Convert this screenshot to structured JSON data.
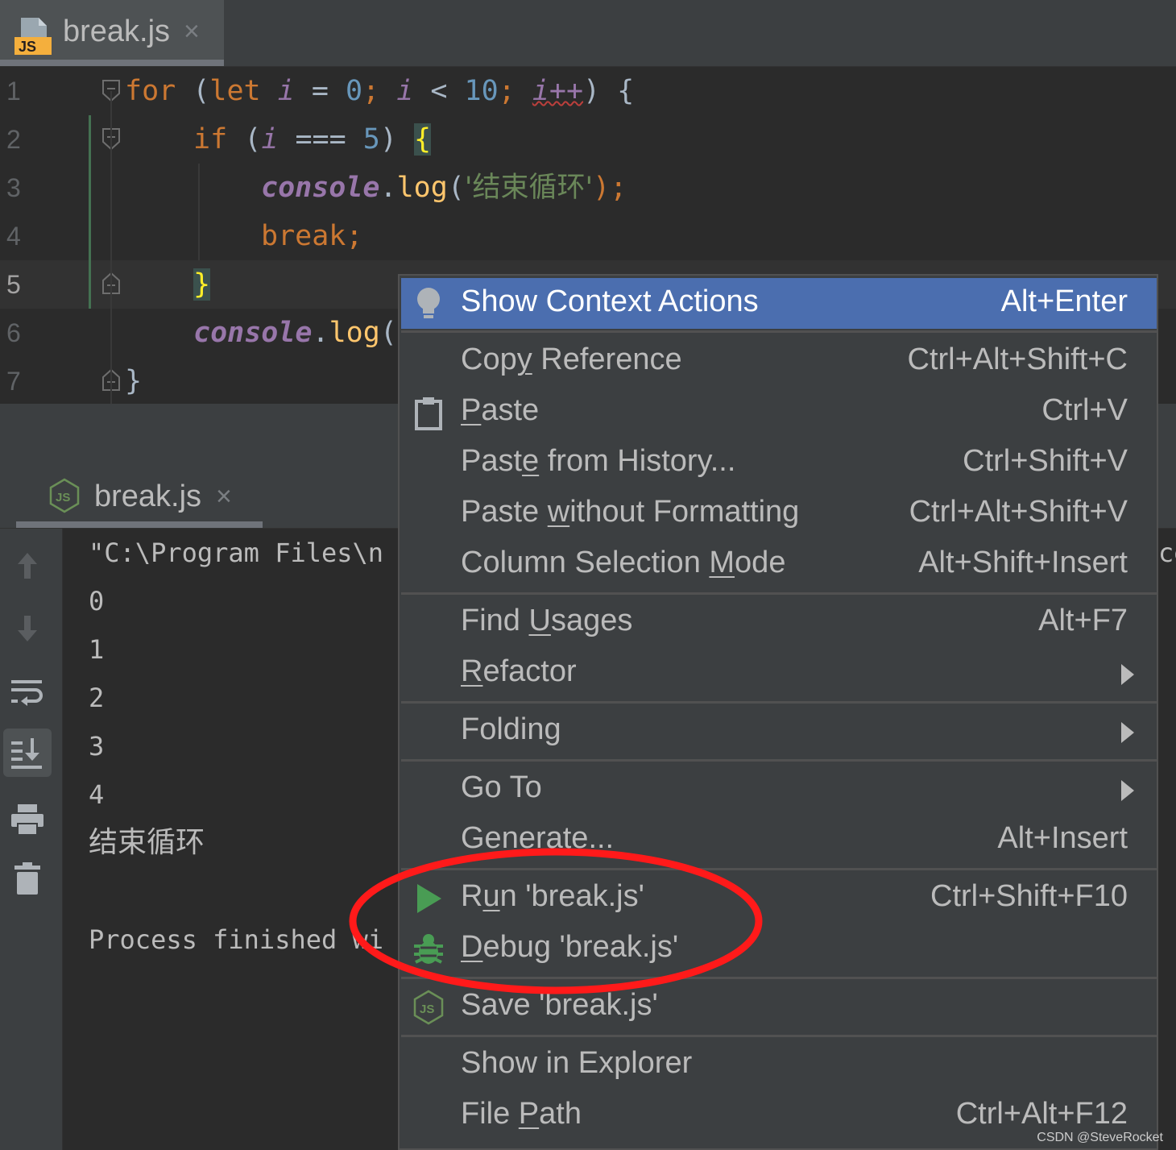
{
  "editor": {
    "tab": {
      "filename": "break.js",
      "icon": "js-file-icon",
      "close": "×"
    },
    "line_numbers": [
      "1",
      "2",
      "3",
      "4",
      "5",
      "6",
      "7"
    ],
    "current_line": 5,
    "code": [
      [
        "for",
        " (",
        "let",
        " ",
        "i",
        " = ",
        "0",
        "; ",
        "i",
        " < ",
        "10",
        "; ",
        "i++",
        ") {"
      ],
      [
        "if",
        " (",
        "i",
        " === ",
        "5",
        ") ",
        "{"
      ],
      [
        "console",
        ".",
        "log",
        "(",
        "'结束循环'",
        ");"
      ],
      [
        "break",
        ";"
      ],
      [
        "}"
      ],
      [
        "console",
        ".",
        "log",
        "("
      ],
      [
        "}"
      ]
    ]
  },
  "run_panel": {
    "tab": {
      "label": "break.js",
      "icon": "nodejs-icon",
      "close": "×"
    },
    "toolbar": [
      "up-arrow-icon",
      "down-arrow-icon",
      "soft-wrap-icon",
      "scroll-to-end-icon",
      "print-icon",
      "trash-icon"
    ],
    "console_lines": [
      "\"C:\\Program Files\\n",
      "0",
      "1",
      "2",
      "3",
      "4",
      "结束循环",
      "",
      "Process finished wi"
    ],
    "console_overflow_char": "ce"
  },
  "context_menu": {
    "items": [
      {
        "label": "Show Context Actions",
        "shortcut": "Alt+Enter",
        "icon": "lightbulb-icon",
        "highlighted": true
      },
      {
        "label": "Copy Reference",
        "shortcut": "Ctrl+Alt+Shift+C"
      },
      {
        "label": "Paste",
        "shortcut": "Ctrl+V",
        "icon": "clipboard-icon"
      },
      {
        "label": "Paste from History...",
        "shortcut": "Ctrl+Shift+V"
      },
      {
        "label": "Paste without Formatting",
        "shortcut": "Ctrl+Alt+Shift+V"
      },
      {
        "label": "Column Selection Mode",
        "shortcut": "Alt+Shift+Insert"
      },
      {
        "label": "Find Usages",
        "shortcut": "Alt+F7"
      },
      {
        "label": "Refactor",
        "submenu": true
      },
      {
        "label": "Folding",
        "submenu": true
      },
      {
        "label": "Go To",
        "submenu": true
      },
      {
        "label": "Generate...",
        "shortcut": "Alt+Insert"
      },
      {
        "label": "Run 'break.js'",
        "shortcut": "Ctrl+Shift+F10",
        "icon": "run-triangle-icon"
      },
      {
        "label": "Debug 'break.js'",
        "icon": "debug-bug-icon"
      },
      {
        "label": "Save 'break.js'",
        "icon": "nodejs-icon"
      },
      {
        "label": "Show in Explorer"
      },
      {
        "label": "File Path",
        "shortcut": "Ctrl+Alt+F12"
      }
    ]
  },
  "watermark": "CSDN @SteveRocket",
  "colors": {
    "menu_highlight": "#4b6eaf",
    "annotation_ellipse": "#ff1a1a",
    "run_green": "#499c54"
  }
}
